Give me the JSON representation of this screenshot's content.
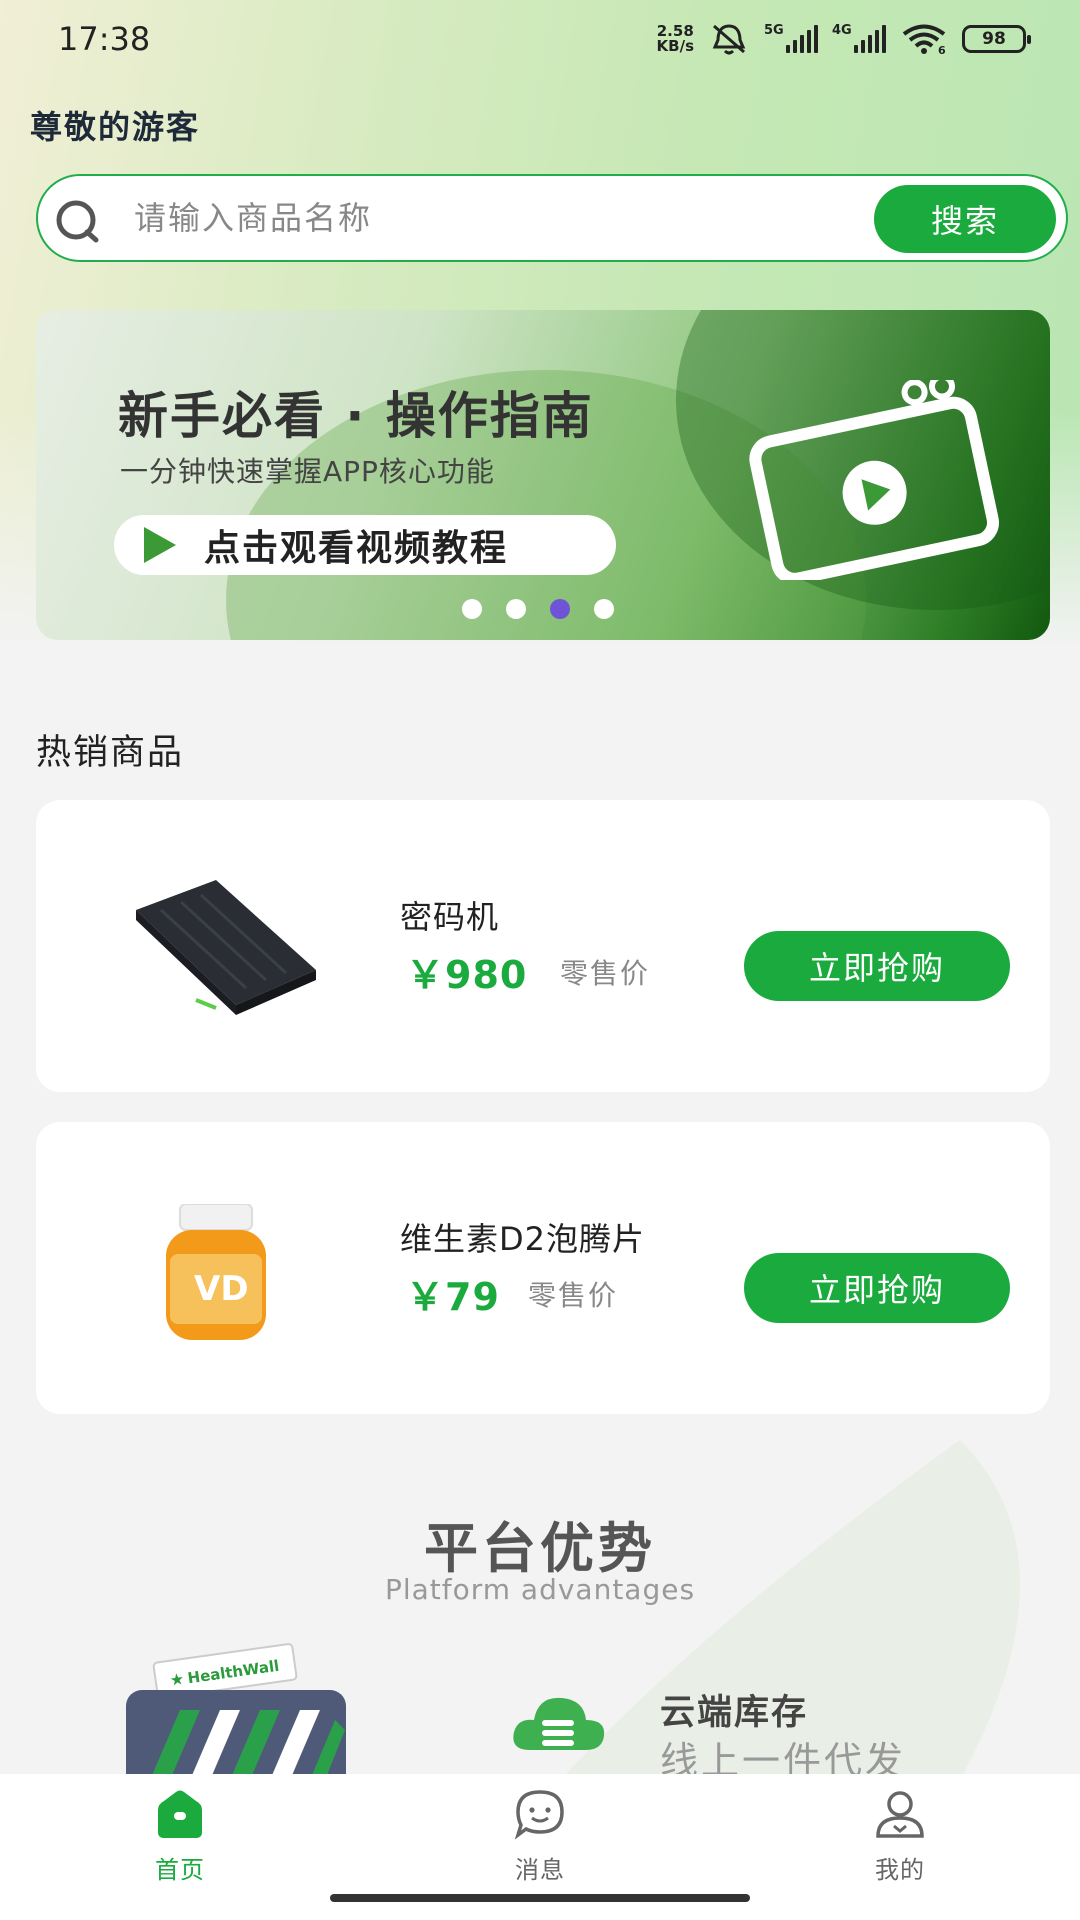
{
  "status_bar": {
    "time": "17:38",
    "net_speed_value": "2.58",
    "net_speed_unit": "KB/s",
    "sim1": "5G",
    "sim2": "4G",
    "battery": "98",
    "wifi_sub": "6"
  },
  "greeting": "尊敬的游客",
  "search": {
    "placeholder": "请输入商品名称",
    "button_label": "搜索"
  },
  "banner": {
    "title": "新手必看 · 操作指南",
    "subtitle": "一分钟快速掌握APP核心功能",
    "button_label": "点击观看视频教程",
    "dots_total": 4,
    "active_dot_index": 2,
    "active_dot_color": "#6f54d8"
  },
  "hot_section": {
    "title": "热销商品",
    "products": [
      {
        "name": "密码机",
        "price": "￥980",
        "price_note": "零售价",
        "button_label": "立即抢购"
      },
      {
        "name": "维生素D2泡腾片",
        "price": "￥79",
        "price_note": "零售价",
        "button_label": "立即抢购"
      }
    ]
  },
  "advantages": {
    "title": "平台优势",
    "subtitle": "Platform advantages",
    "store_sign": "HealthWall",
    "feature": {
      "title": "云端库存",
      "subtitle": "线上一件代发"
    }
  },
  "tabbar": {
    "items": [
      {
        "label": "首页",
        "icon": "home-icon",
        "active": true
      },
      {
        "label": "消息",
        "icon": "message-icon",
        "active": false
      },
      {
        "label": "我的",
        "icon": "profile-icon",
        "active": false
      }
    ]
  },
  "colors": {
    "accent": "#1aaa3e",
    "inactive_tab": "#666666",
    "background": "#f3f3f3"
  }
}
